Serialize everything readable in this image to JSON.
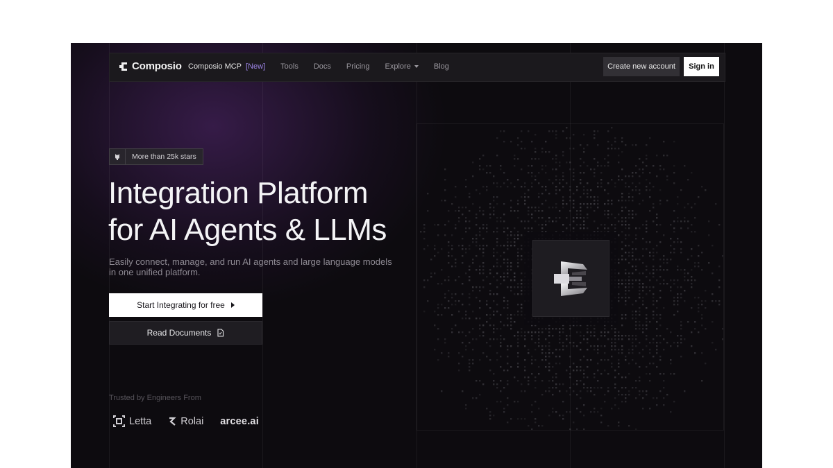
{
  "nav": {
    "brand": "Composio",
    "links": {
      "mcp": "Composio MCP",
      "mcp_badge": "[New]",
      "tools": "Tools",
      "docs": "Docs",
      "pricing": "Pricing",
      "explore": "Explore",
      "blog": "Blog"
    },
    "create_account": "Create new account",
    "sign_in": "Sign in"
  },
  "hero": {
    "badge": "More than 25k stars",
    "title_line1": "Integration Platform",
    "title_line2": "for AI Agents & LLMs",
    "subtitle": "Easily connect, manage, and run AI agents and large language models in one unified platform.",
    "cta_primary": "Start Integrating for free",
    "cta_secondary": "Read Documents",
    "trusted_label": "Trusted by Engineers From",
    "trusted_logos": [
      "Letta",
      "Rolai",
      "arcee.ai"
    ]
  },
  "colors": {
    "background": "#0d0b0f",
    "accent_purple": "#9c84e6",
    "nav_bg": "#1b191d"
  },
  "icons": {
    "brand": "composio-logo-icon",
    "badge": "github-icon",
    "cta_primary": "play-icon",
    "cta_secondary": "document-icon",
    "center": "composio-3d-logo-icon"
  }
}
